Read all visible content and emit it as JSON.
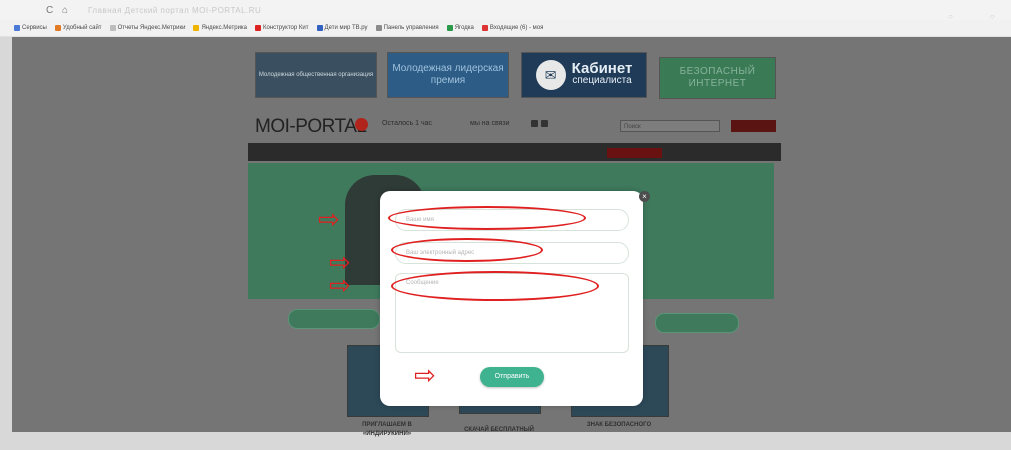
{
  "browser": {
    "nav_back": "C",
    "nav_home": "⌂",
    "url": "Главная Детский портал MOI-PORTAL.RU",
    "bookmarks": [
      {
        "label": "Сервисы",
        "color": "#4a7ad6"
      },
      {
        "label": "Удобный сайт",
        "color": "#e07a24"
      },
      {
        "label": "Отчеты Яндекс.Метрики",
        "color": "#bdbdbd"
      },
      {
        "label": "Яндекс.Метрика",
        "color": "#f0b400"
      },
      {
        "label": "Конструктор Кит",
        "color": "#d22"
      },
      {
        "label": "Дети мир ТВ.ру",
        "color": "#3060c0"
      },
      {
        "label": "Панель управления",
        "color": "#8a8a8a"
      },
      {
        "label": "Ягодка",
        "color": "#2a9a4a"
      },
      {
        "label": "Входящие (6) - моя",
        "color": "#d33"
      }
    ]
  },
  "site": {
    "banners": {
      "b1": "Молодежная общественная организация",
      "b2": "Молодежная лидерская премия",
      "b3_title": "Кабинет",
      "b3_sub": "специалиста",
      "b4": "БЕЗОПАСНЫЙ ИНТЕРНЕТ"
    },
    "logo": "MOI-PORTAL",
    "header_text1": "Осталось 1 час",
    "header_text2": "мы на связи",
    "search_placeholder": "Поиск",
    "pills": [
      "",
      ""
    ],
    "captions": [
      "ПРИГЛАШАЕМ В «ИНДИРУКИНИ»",
      "СКАЧАЙ БЕСПЛАТНЫЙ",
      "ЗНАК БЕЗОПАСНОГО"
    ]
  },
  "modal": {
    "close": "×",
    "field_name_placeholder": "Ваше имя",
    "field_email_placeholder": "Ваш электронный адрес",
    "field_message_placeholder": "Сообщение",
    "submit_label": "Отправить"
  },
  "annotations": {
    "arrow_glyph": "⇨",
    "color": "#e02020"
  }
}
